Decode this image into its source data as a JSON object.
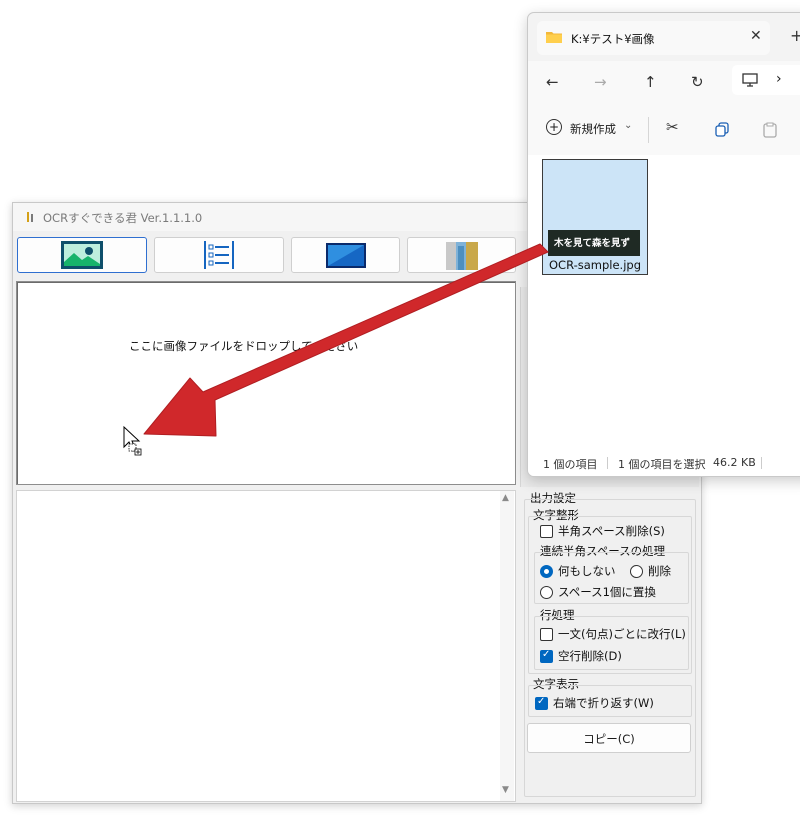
{
  "ocr_window": {
    "title": "OCRすぐできる君 Ver.1.1.1.0",
    "drop_hint": "ここに画像ファイルをドロップしてください",
    "toolbar": [
      {
        "name": "image-mode-button",
        "icon": "image-icon",
        "active": true
      },
      {
        "name": "list-mode-button",
        "icon": "list-icon",
        "active": false
      },
      {
        "name": "screen-mode-button",
        "icon": "screen-icon",
        "active": false
      },
      {
        "name": "capture-mode-button",
        "icon": "capture-icon",
        "active": false
      }
    ],
    "settings": {
      "group_title": "出力設定",
      "text_format": {
        "title": "文字整形",
        "halfwidth_space_delete": "半角スペース削除(S)",
        "halfwidth_space_delete_checked": false,
        "consecutive": {
          "title": "連続半角スペースの処理",
          "options": [
            "何もしない",
            "削除",
            "スペース1個に置換"
          ],
          "selected": "何もしない"
        },
        "line": {
          "title": "行処理",
          "per_sentence_break": "一文(句点)ごとに改行(L)",
          "per_sentence_break_checked": false,
          "delete_empty_lines": "空行削除(D)",
          "delete_empty_lines_checked": true
        }
      },
      "display": {
        "title": "文字表示",
        "wrap": "右端で折り返す(W)",
        "wrap_checked": true
      },
      "copy_button": "コピー(C)"
    }
  },
  "explorer": {
    "tab_title": "K:¥テスト¥画像",
    "new_label": "新規作成",
    "file": {
      "name": "OCR-sample.jpg",
      "thumbnail_text": "木を見て森を見ず"
    },
    "status": {
      "count": "1 個の項目",
      "selected": "1 個の項目を選択",
      "size": "46.2 KB"
    }
  },
  "colors": {
    "accent": "#0067c0",
    "arrow": "#d0282b",
    "selection": "#cce4f7"
  }
}
